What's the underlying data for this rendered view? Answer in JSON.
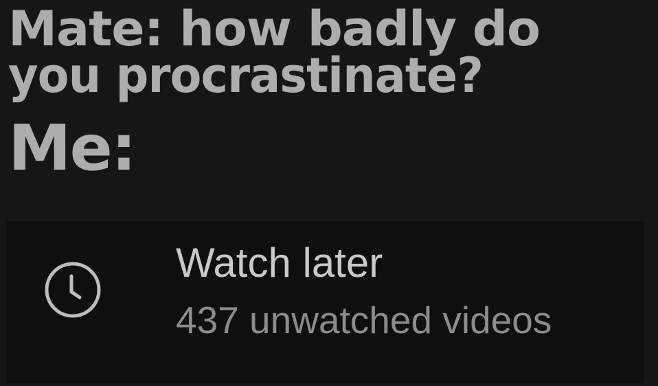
{
  "caption": {
    "line1": "Mate: how badly do",
    "line2": "you procrastinate?",
    "line3": "Me:"
  },
  "playlist": {
    "icon": "clock-icon",
    "title": "Watch later",
    "subtitle": "437 unwatched videos"
  },
  "colors": {
    "background": "#161616",
    "row_background": "#0f0f0f",
    "caption_text": "#adadad",
    "title_text": "#c9c9c9",
    "subtitle_text": "#8c8c8c"
  }
}
